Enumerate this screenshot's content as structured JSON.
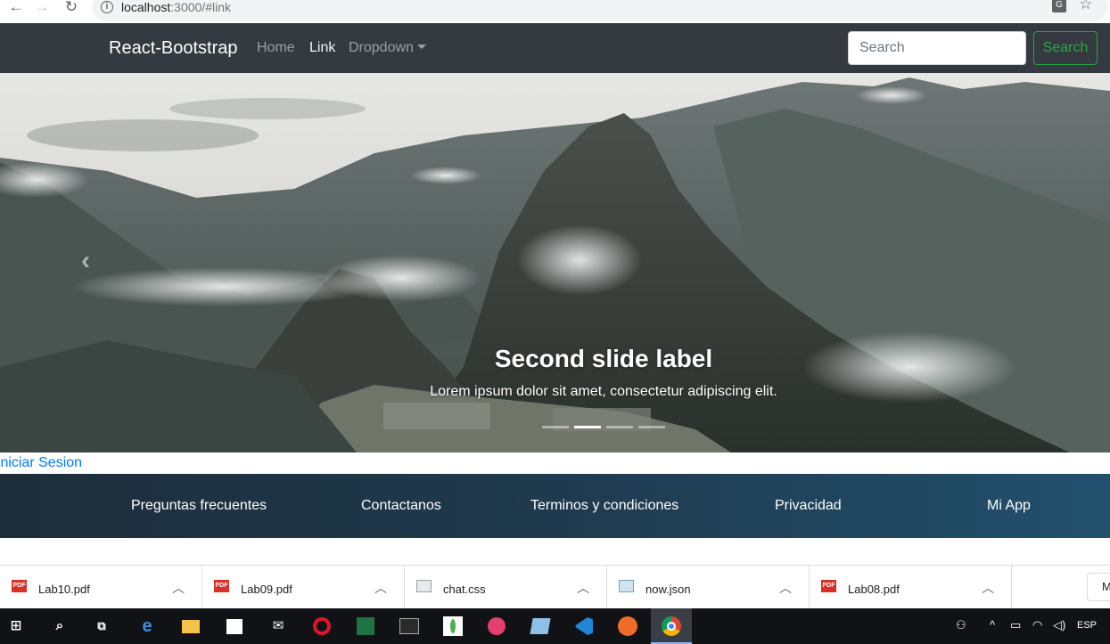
{
  "browser": {
    "url_host": "localhost",
    "url_path": ":3000/#link",
    "info_glyph": "i",
    "translate_glyph": "G"
  },
  "navbar": {
    "brand": "React-Bootstrap",
    "links": [
      {
        "label": "Home"
      },
      {
        "label": "Link"
      },
      {
        "label": "Dropdown"
      }
    ],
    "search_placeholder": "Search",
    "search_button": "Search"
  },
  "carousel": {
    "caption_title": "Second slide label",
    "caption_text": "Lorem ipsum dolor sit amet, consectetur adipiscing elit.",
    "prev_glyph": "‹",
    "slide_count": 4,
    "active_index": 1
  },
  "login_link": "Iniciar Sesion",
  "footer": {
    "links": [
      {
        "label": "Preguntas frecuentes"
      },
      {
        "label": "Contactanos"
      },
      {
        "label": "Terminos y condiciones"
      },
      {
        "label": "Privacidad"
      },
      {
        "label": "Mi App"
      }
    ]
  },
  "downloads": {
    "items": [
      {
        "name": "Lab10.pdf",
        "icon": "pdf-file-icon",
        "badge": "PDF"
      },
      {
        "name": "Lab09.pdf",
        "icon": "pdf-file-icon",
        "badge": "PDF"
      },
      {
        "name": "chat.css",
        "icon": "css-file-icon",
        "badge": ""
      },
      {
        "name": "now.json",
        "icon": "json-file-icon",
        "badge": ""
      },
      {
        "name": "Lab08.pdf",
        "icon": "pdf-file-icon",
        "badge": "PDF"
      }
    ],
    "show_all_label": "M"
  },
  "taskbar": {
    "language": "ESP",
    "apps": [
      "windows-start-icon",
      "search-icon",
      "task-view-icon",
      "edge-icon",
      "file-explorer-icon",
      "store-icon",
      "mail-icon",
      "opera-icon",
      "excel-icon",
      "terminal-icon",
      "mongodb-icon",
      "camera-icon",
      "notepad-icon",
      "vscode-icon",
      "postman-icon",
      "chrome-icon"
    ]
  },
  "colors": {
    "navbar_bg": "#343a40",
    "success": "#28a745",
    "link": "#007bff",
    "footer_bg": "#1f3a4e"
  }
}
